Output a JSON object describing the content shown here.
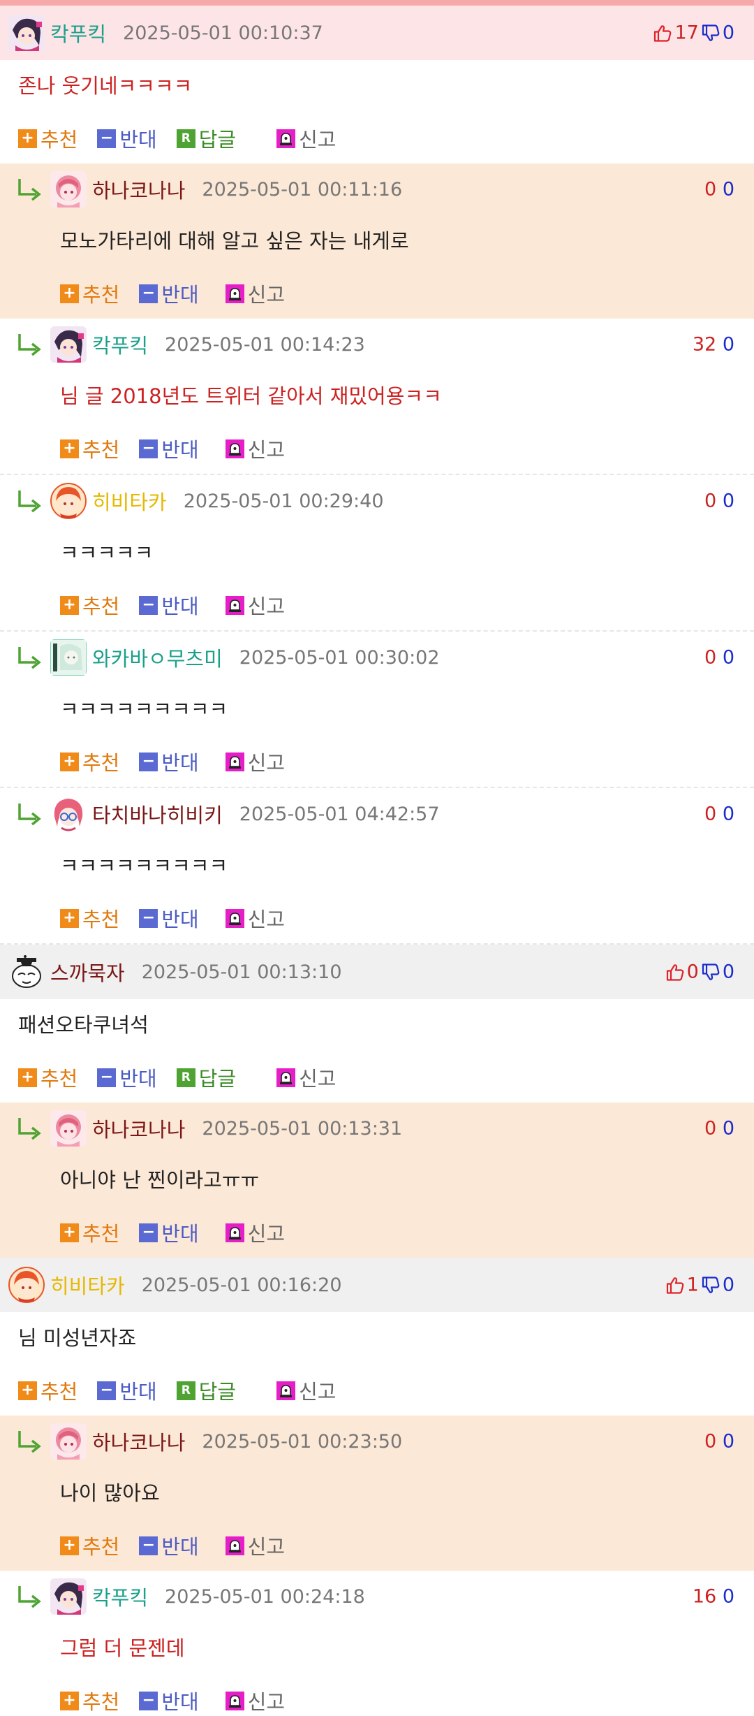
{
  "labels": {
    "recommend": "추천",
    "oppose": "반대",
    "reply": "답글",
    "report": "신고"
  },
  "comments": [
    {
      "type": "root",
      "bg": "pink",
      "avatar": "kak",
      "nick": "칵푸킥",
      "nick_color": "kak",
      "date": "2025-05-01 00:10:37",
      "up": "17",
      "down": "0",
      "thumbs": true,
      "text": "존나 웃기네ㅋㅋㅋㅋ",
      "text_red": true
    },
    {
      "type": "reply",
      "bg": "peach",
      "avatar": "hana",
      "nick": "하나코나나",
      "nick_color": "hana",
      "date": "2025-05-01 00:11:16",
      "up": "0",
      "down": "0",
      "thumbs": false,
      "text": "모노가타리에 대해 알고 싶은 자는 내게로",
      "text_red": false
    },
    {
      "type": "reply",
      "bg": "white",
      "avatar": "kak",
      "nick": "칵푸킥",
      "nick_color": "kak",
      "date": "2025-05-01 00:14:23",
      "up": "32",
      "down": "0",
      "thumbs": false,
      "text": "님 글 2018년도 트위터 같아서 재밌어용ㅋㅋ",
      "text_red": true
    },
    {
      "type": "reply",
      "bg": "white",
      "avatar": "hibi",
      "nick": "히비타카",
      "nick_color": "hibi",
      "date": "2025-05-01 00:29:40",
      "up": "0",
      "down": "0",
      "thumbs": false,
      "text": "ㅋㅋㅋㅋㅋ",
      "text_red": false
    },
    {
      "type": "reply",
      "bg": "white",
      "avatar": "waka",
      "nick": "와카바ㅇ무츠미",
      "nick_color": "waka",
      "date": "2025-05-01 00:30:02",
      "up": "0",
      "down": "0",
      "thumbs": false,
      "text": "ㅋㅋㅋㅋㅋㅋㅋㅋㅋ",
      "text_red": false
    },
    {
      "type": "reply",
      "bg": "white",
      "avatar": "tachi",
      "nick": "타치바나히비키",
      "nick_color": "tachi",
      "date": "2025-05-01 04:42:57",
      "up": "0",
      "down": "0",
      "thumbs": false,
      "text": "ㅋㅋㅋㅋㅋㅋㅋㅋㅋ",
      "text_red": false
    },
    {
      "type": "root",
      "bg": "gray",
      "avatar": "seuk",
      "nick": "스까묵자",
      "nick_color": "seuk",
      "date": "2025-05-01 00:13:10",
      "up": "0",
      "down": "0",
      "thumbs": true,
      "text": "패션오타쿠녀석",
      "text_red": false
    },
    {
      "type": "reply",
      "bg": "peach",
      "avatar": "hana",
      "nick": "하나코나나",
      "nick_color": "hana",
      "date": "2025-05-01 00:13:31",
      "up": "0",
      "down": "0",
      "thumbs": false,
      "text": "아니야 난 찐이라고ㅠㅠ",
      "text_red": false
    },
    {
      "type": "root",
      "bg": "gray",
      "avatar": "hibi",
      "nick": "히비타카",
      "nick_color": "hibi",
      "date": "2025-05-01 00:16:20",
      "up": "1",
      "down": "0",
      "thumbs": true,
      "text": "님 미성년자죠",
      "text_red": false
    },
    {
      "type": "reply",
      "bg": "peach",
      "avatar": "hana",
      "nick": "하나코나나",
      "nick_color": "hana",
      "date": "2025-05-01 00:23:50",
      "up": "0",
      "down": "0",
      "thumbs": false,
      "text": "나이 많아요",
      "text_red": false
    },
    {
      "type": "reply",
      "bg": "white",
      "avatar": "kak",
      "nick": "칵푸킥",
      "nick_color": "kak",
      "date": "2025-05-01 00:24:18",
      "up": "16",
      "down": "0",
      "thumbs": false,
      "text": "그럼 더 문젠데",
      "text_red": true
    }
  ]
}
